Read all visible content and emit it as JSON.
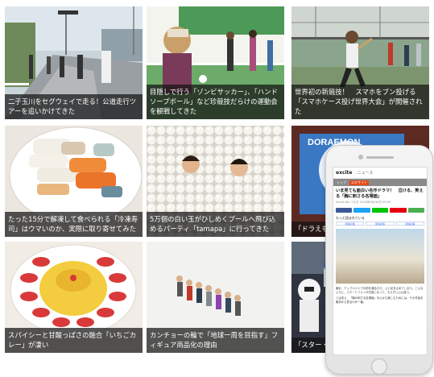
{
  "tiles": [
    {
      "id": "segway",
      "caption": "二子玉川をセグウェイで走る！公道走行ツアーを追いかけてきた"
    },
    {
      "id": "zombie-soccer",
      "caption": "目隠しで行う「ゾンビサッカー」、「ハンドソープボール」など珍競技だらけの運動会を観戦してきた"
    },
    {
      "id": "phone-throw",
      "caption": "世界初の新競技！　スマホをブン投げる「スマホケース投げ世界大会」が開催された"
    },
    {
      "id": "frozen-sushi",
      "caption": "たった15分で解凍して食べられる「冷凍寿司」はウマいのか、実際に取り寄せてみた"
    },
    {
      "id": "ball-pool",
      "caption": "5万個の白い玉がひしめくプールへ飛び込めるパーティ「tamapa」に行ってきた"
    },
    {
      "id": "doraemon",
      "caption": "「ドラえもん んでことはな"
    },
    {
      "id": "strawberry-curry",
      "caption": "スパイシーと甘酸っぱさの融合「いちごカレー」が凄い"
    },
    {
      "id": "figures",
      "caption": "カンチョーの輪で「地球一周を目指す」フィギュア商品化の理由"
    },
    {
      "id": "starwars",
      "caption": "「スター・ウ 騒ぎ　スペ"
    }
  ],
  "phone": {
    "logo": "excite",
    "logo_suffix": ". ニュース",
    "tabs": [
      "トップ",
      "エキサイト"
    ],
    "article_title": "いま見ても面白い名作ドラマ！　泣ける、笑える「胸に刺さる名場面」",
    "meta": "Excite Bit コネタ 2018年3月30日 09:00",
    "share": [
      {
        "label": "",
        "color": "#3b5998"
      },
      {
        "label": "",
        "color": "#1da1f2"
      },
      {
        "label": "",
        "color": "#00c300"
      },
      {
        "label": "",
        "color": "#e60012"
      },
      {
        "label": "",
        "color": "#4caf50"
      }
    ],
    "related_title": "もっと読まれている",
    "related": [
      "関連記事",
      "関連記事",
      "関連記事"
    ],
    "body": [
      "最近、アップルストアの前を通るたび、ふと足を止めてしまう。こんなふうに、スマートフォンが日常になって、もうずいぶん経つ。",
      "とは言え、「胸の刺さる名場面」を心から楽しむためには、その作品を最初から見るのが一番。"
    ]
  }
}
